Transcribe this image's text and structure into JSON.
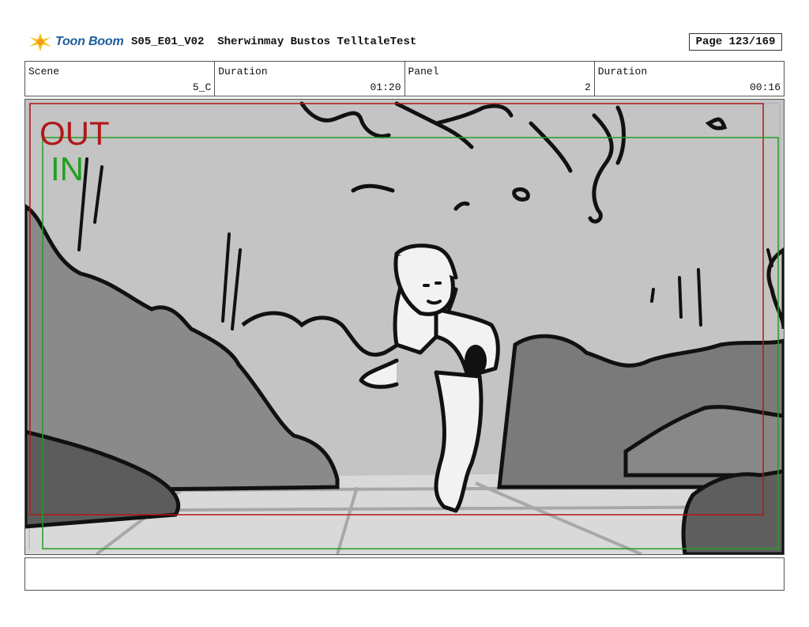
{
  "header": {
    "logo_text": "Toon Boom",
    "title": "S05_E01_V02  Sherwinmay Bustos TelltaleTest",
    "page": "Page 123/169"
  },
  "info": {
    "scene_label": "Scene",
    "scene_value": "5_C",
    "scene_duration_label": "Duration",
    "scene_duration_value": "01:20",
    "panel_label": "Panel",
    "panel_value": "2",
    "panel_duration_label": "Duration",
    "panel_duration_value": "00:16"
  },
  "panel": {
    "out_label": "OUT",
    "in_label": "IN",
    "out_frame_color": "#b01818",
    "in_frame_color": "#20a020"
  },
  "notes": {
    "text": ""
  }
}
